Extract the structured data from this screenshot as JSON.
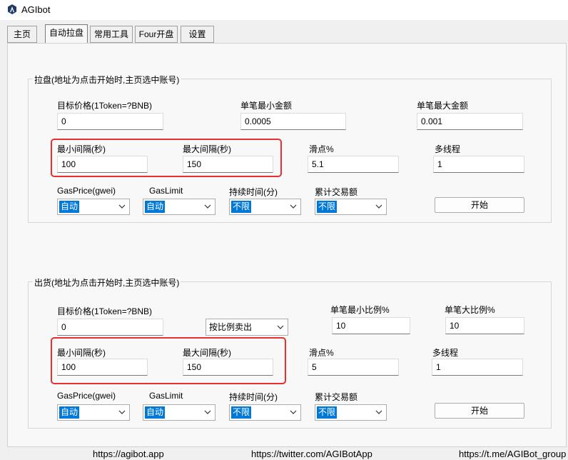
{
  "window": {
    "title": "AGIbot"
  },
  "tabs": [
    "主页",
    "自动拉盘",
    "常用工具",
    "Four开盘",
    "设置"
  ],
  "pump": {
    "title": "拉盘(地址为点击开始时,主页选中账号)",
    "target_price_label": "目标价格(1Token=?BNB)",
    "target_price_value": "0",
    "min_single_label": "单笔最小金额",
    "min_single_value": "0.0005",
    "max_single_label": "单笔最大金额",
    "max_single_value": "0.001",
    "min_interval_label": "最小间隔(秒)",
    "min_interval_value": "100",
    "max_interval_label": "最大间隔(秒)",
    "max_interval_value": "150",
    "slippage_label": "滑点%",
    "slippage_value": "5.1",
    "threads_label": "多线程",
    "threads_value": "1",
    "gasprice_label": "GasPrice(gwei)",
    "gasprice_value": "自动",
    "gaslimit_label": "GasLimit",
    "gaslimit_value": "自动",
    "duration_label": "持续时间(分)",
    "duration_value": "不限",
    "volume_label": "累计交易额",
    "volume_value": "不限",
    "start_label": "开始"
  },
  "sell": {
    "title": "出货(地址为点击开始时,主页选中账号)",
    "target_price_label": "目标价格(1Token=?BNB)",
    "target_price_value": "0",
    "mode_value": "按比例卖出",
    "min_ratio_label": "单笔最小比例%",
    "min_ratio_value": "10",
    "max_ratio_label": "单笔大比例%",
    "max_ratio_value": "10",
    "min_interval_label": "最小间隔(秒)",
    "min_interval_value": "100",
    "max_interval_label": "最大间隔(秒)",
    "max_interval_value": "150",
    "slippage_label": "滑点%",
    "slippage_value": "5",
    "threads_label": "多线程",
    "threads_value": "1",
    "gasprice_label": "GasPrice(gwei)",
    "gasprice_value": "自动",
    "gaslimit_label": "GasLimit",
    "gaslimit_value": "自动",
    "duration_label": "持续时间(分)",
    "duration_value": "不限",
    "volume_label": "累计交易额",
    "volume_value": "不限",
    "start_label": "开始"
  },
  "footer": {
    "website": "https://agibot.app",
    "twitter": "https://twitter.com/AGIBotApp",
    "telegram": "https://t.me/AGIBot_group"
  },
  "colors": {
    "highlight": "#0078d7",
    "annotation": "#e53030"
  }
}
